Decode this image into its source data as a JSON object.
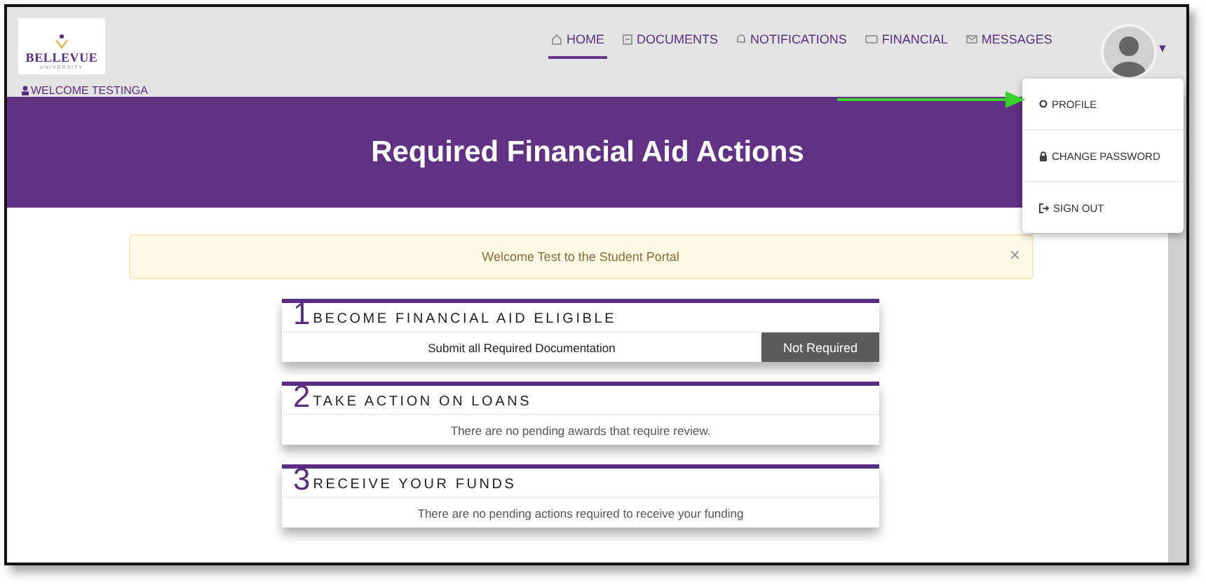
{
  "logo": {
    "name": "BELLEVUE",
    "sub": "UNIVERSITY"
  },
  "welcome_user": "WELCOME TESTINGA",
  "nav": [
    {
      "label": "HOME",
      "selected": true
    },
    {
      "label": "DOCUMENTS",
      "selected": false
    },
    {
      "label": "NOTIFICATIONS",
      "selected": false
    },
    {
      "label": "FINANCIAL",
      "selected": false
    },
    {
      "label": "MESSAGES",
      "selected": false
    }
  ],
  "user_menu": {
    "toggle": "▼",
    "expanded": true,
    "items": [
      {
        "label": "PROFILE"
      },
      {
        "label": "CHANGE PASSWORD"
      },
      {
        "label": "SIGN OUT"
      }
    ]
  },
  "banner_title": "Required Financial Aid Actions",
  "alert": {
    "message": "Welcome Test to the Student Portal",
    "close": "×"
  },
  "steps": [
    {
      "number": "1",
      "title": "BECOME FINANCIAL AID ELIGIBLE",
      "kind": "status",
      "text": "Submit all Required Documentation",
      "status": "Not Required"
    },
    {
      "number": "2",
      "title": "TAKE ACTION ON LOANS",
      "kind": "message",
      "text": "There are no pending awards that require review."
    },
    {
      "number": "3",
      "title": "RECEIVE YOUR FUNDS",
      "kind": "message",
      "text": "There are no pending actions required to receive your funding"
    }
  ]
}
